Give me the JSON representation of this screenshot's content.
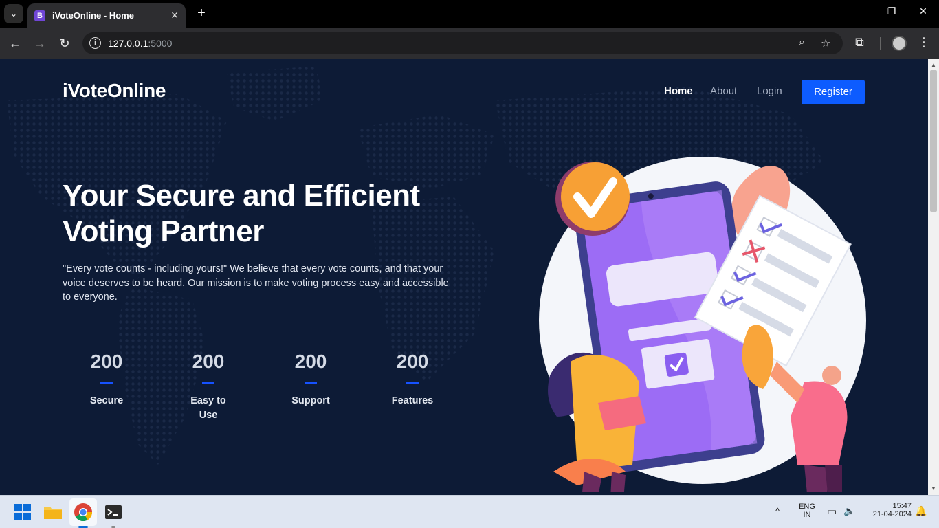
{
  "browser": {
    "tab_title": "iVoteOnline - Home",
    "tab_favicon": "B",
    "url_host": "127.0.0.1",
    "url_port": ":5000"
  },
  "site": {
    "brand": "iVoteOnline",
    "nav": {
      "home": "Home",
      "about": "About",
      "login": "Login",
      "register": "Register"
    },
    "hero": {
      "title": "Your Secure and Efficient Voting Partner",
      "text": "\"Every vote counts - including yours!\" We believe that every vote counts, and that your voice deserves to be heard. Our mission is to make voting process easy and accessible to everyone."
    },
    "stats": [
      {
        "value": "200",
        "label": "Secure"
      },
      {
        "value": "200",
        "label": "Easy to Use"
      },
      {
        "value": "200",
        "label": "Support"
      },
      {
        "value": "200",
        "label": "Features"
      }
    ]
  },
  "taskbar": {
    "lang_top": "ENG",
    "lang_bottom": "IN",
    "time": "15:47",
    "date": "21-04-2024"
  },
  "colors": {
    "page_bg": "#0d1b36",
    "accent": "#0d5cff"
  }
}
